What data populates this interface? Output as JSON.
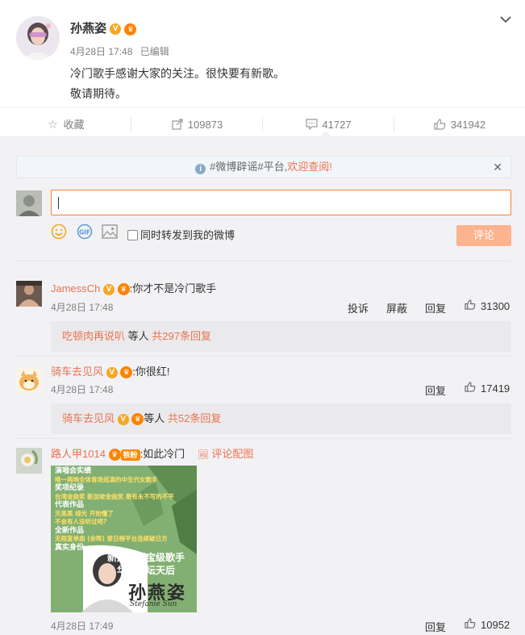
{
  "post": {
    "author": "孙燕姿",
    "time": "4月28日 17:48",
    "edited": "已编辑",
    "text_line1": "冷门歌手感谢大家的关注。很快要有新歌。",
    "text_line2": "敬请期待。"
  },
  "actions": {
    "favorite_label": "收藏",
    "repost_count": "109873",
    "comment_count": "41727",
    "like_count": "341942"
  },
  "notice": {
    "prefix": "#微博辟谣#平台,",
    "link": "欢迎查阅!"
  },
  "composer": {
    "repost_checkbox_label": "同时转发到我的微博",
    "submit_label": "评论"
  },
  "comments": [
    {
      "author": "JamessCh",
      "text": ":你才不是冷门歌手",
      "time": "4月28日 17:48",
      "complain": "投诉",
      "block": "屏蔽",
      "reply": "回复",
      "likes": "31300",
      "sub_author": "吃顿肉再说叭",
      "sub_middle": " 等人 ",
      "sub_count": "共297条回复"
    },
    {
      "author": "骑车去见风",
      "text": ":你很红!",
      "time": "4月28日 17:48",
      "reply": "回复",
      "likes": "17419",
      "sub_author": "骑车去见风",
      "sub_middle": "等人 ",
      "sub_count": "共52条回复"
    },
    {
      "author": "路人甲1014",
      "fan_badge": "铁粉",
      "text": ":如此冷门",
      "pic_link": "评论配图",
      "time": "4月28日 17:49",
      "reply": "回复",
      "likes": "10952"
    }
  ],
  "poster": {
    "lines": [
      "演唱会实绩",
      "唯一两地全体育场巡演的中生代女歌手",
      "奖项纪录",
      "台湾金曲奖 新加坡金曲奖 是有永不写的不平",
      "代表作品",
      "天黑黑 绿光 开始懂了",
      "不会有人没听过吧?",
      "全新作品",
      "无限复单曲 (余晖) 登日榜平台连续破日方",
      "真实身份",
      "新加坡国宝级歌手",
      "华语乐坛天后"
    ],
    "name_cn": "孙燕姿",
    "name_en": "Stefanie Sun"
  },
  "colors": {
    "accent": "#eb7350",
    "panel_bg": "#f2f2f5",
    "poster_green": "#7fae6e"
  }
}
